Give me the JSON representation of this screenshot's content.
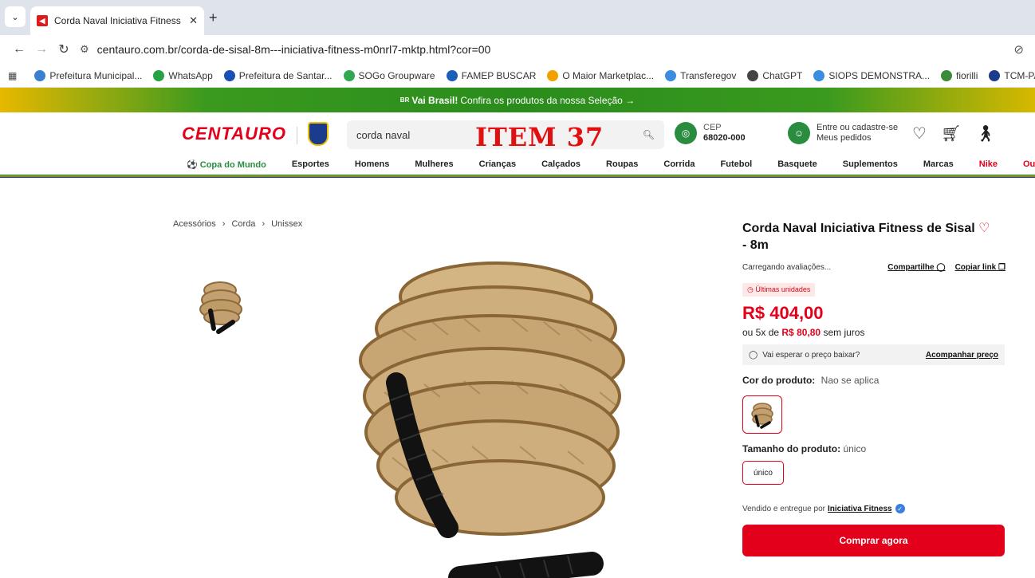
{
  "browser": {
    "tab_title": "Corda Naval Iniciativa Fitness de",
    "tab_close": "✕",
    "new_tab": "+",
    "url": "centauro.com.br/corda-de-sisal-8m---iniciativa-fitness-m0nrl7-mktp.html?cor=00",
    "bookmarks": [
      {
        "label": "Prefeitura Municipal...",
        "color": "#3b7fd1"
      },
      {
        "label": "WhatsApp",
        "color": "#25a244"
      },
      {
        "label": "Prefeitura de Santar...",
        "color": "#1a4fb5"
      },
      {
        "label": "SOGo Groupware",
        "color": "#2fa84f"
      },
      {
        "label": "FAMEP BUSCAR",
        "color": "#1b5fb8"
      },
      {
        "label": "O Maior Marketplac...",
        "color": "#f2a000"
      },
      {
        "label": "Transferegov",
        "color": "#3b8de0"
      },
      {
        "label": "ChatGPT",
        "color": "#444444"
      },
      {
        "label": "SIOPS DEMONSTRA...",
        "color": "#3b8de0"
      },
      {
        "label": "fiorilli",
        "color": "#3a8c3a"
      },
      {
        "label": "TCM-PA - Portal",
        "color": "#1b3c8c"
      }
    ]
  },
  "site": {
    "promo_prefix": "BR",
    "promo_bold": "Vai Brasil!",
    "promo_text": "Confira os produtos da nossa Seleção →",
    "logo": "CENTAURO",
    "search_value": "corda naval",
    "overlay_text": "ITEM 37",
    "cep_label": "CEP",
    "cep_value": "68020-000",
    "account_line1": "Entre ou cadastre-se",
    "account_line2": "Meus pedidos",
    "nav": [
      "Copa do Mundo",
      "Esportes",
      "Homens",
      "Mulheres",
      "Crianças",
      "Calçados",
      "Roupas",
      "Corrida",
      "Futebol",
      "Basquete",
      "Suplementos",
      "Marcas",
      "Nike",
      "Outlet"
    ]
  },
  "product": {
    "breadcrumb": [
      "Acessórios",
      "›",
      "Corda",
      "›",
      "Unissex"
    ],
    "title": "Corda Naval Iniciativa Fitness de Sisal",
    "title_end": "- 8m",
    "loading_reviews": "Carregando avaliações...",
    "share": "Compartilhe",
    "copy_link": "Copiar link",
    "tag": "Últimas unidades",
    "price": "R$ 404,00",
    "installment_prefix": "ou 5x de",
    "installment_value": "R$ 80,80",
    "installment_suffix": "sem juros",
    "watch_label": "Vai esperar o preço baixar?",
    "watch_link": "Acompanhar preço",
    "color_label": "Cor do produto:",
    "color_value": "Nao se aplica",
    "size_label": "Tamanho do produto:",
    "size_value": "único",
    "size_option": "único",
    "seller_prefix": "Vendido e entregue por",
    "seller_name": "Iniciativa Fitness",
    "buy_button": "Comprar agora"
  },
  "colors": {
    "brand_red": "#e3001b",
    "green": "#2a8c3f"
  }
}
